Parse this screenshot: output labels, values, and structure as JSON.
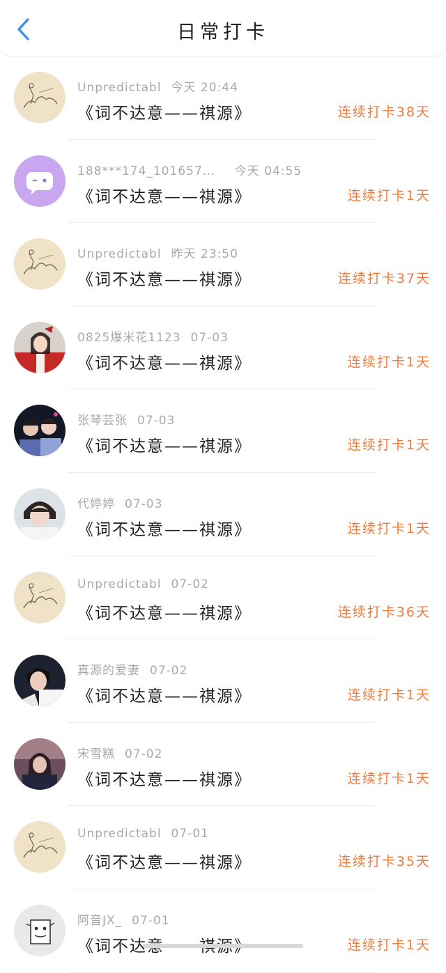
{
  "header": {
    "title": "日常打卡"
  },
  "entries": [
    {
      "user": "Unpredictabl",
      "time": "今天 20:44",
      "book": "《词不达意——祺源》",
      "streak": "连续打卡38天"
    },
    {
      "user": "188***174_101657…",
      "time": "今天 04:55",
      "book": "《词不达意——祺源》",
      "streak": "连续打卡1天"
    },
    {
      "user": "Unpredictabl",
      "time": "昨天 23:50",
      "book": "《词不达意——祺源》",
      "streak": "连续打卡37天"
    },
    {
      "user": "0825爆米花1123",
      "time": "07-03",
      "book": "《词不达意——祺源》",
      "streak": "连续打卡1天"
    },
    {
      "user": "张琴芸张",
      "time": "07-03",
      "book": "《词不达意——祺源》",
      "streak": "连续打卡1天"
    },
    {
      "user": "代婷婷",
      "time": "07-03",
      "book": "《词不达意——祺源》",
      "streak": "连续打卡1天"
    },
    {
      "user": "Unpredictabl",
      "time": "07-02",
      "book": "《词不达意——祺源》",
      "streak": "连续打卡36天"
    },
    {
      "user": "真源的爱妻",
      "time": "07-02",
      "book": "《词不达意——祺源》",
      "streak": "连续打卡1天"
    },
    {
      "user": "宋雪糕",
      "time": "07-02",
      "book": "《词不达意——祺源》",
      "streak": "连续打卡1天"
    },
    {
      "user": "Unpredictabl",
      "time": "07-01",
      "book": "《词不达意——祺源》",
      "streak": "连续打卡35天"
    },
    {
      "user": "阿音JX_",
      "time": "07-01",
      "book": "《词不达意——祺源》",
      "streak": "连续打卡1天"
    }
  ],
  "colors": {
    "accent": "#ee7b3c",
    "back": "#3b8ff0",
    "meta": "#a9a9a9"
  }
}
